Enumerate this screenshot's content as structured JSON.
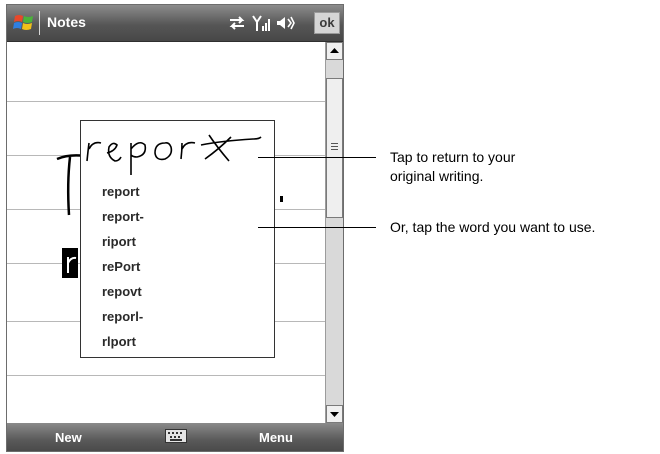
{
  "titlebar": {
    "app_title": "Notes",
    "ok_label": "ok",
    "icons": [
      "windows-start-icon",
      "sync-arrows-icon",
      "signal-strength-icon",
      "speaker-icon"
    ]
  },
  "popup": {
    "suggestions": [
      "report",
      "report-",
      "riport",
      "rePort",
      "repovt",
      "reporl-",
      "rlport"
    ]
  },
  "callouts": {
    "first": [
      "Tap to return to your",
      "original writing."
    ],
    "second": "Or, tap the word you want to use."
  },
  "menubar": {
    "left_label": "New",
    "right_label": "Menu",
    "center_icon": "keyboard-icon"
  },
  "colors": {
    "bar_dark": "#4a4a4a",
    "bar_light": "#8c8c8c",
    "rule_line": "#b8b8b8"
  }
}
